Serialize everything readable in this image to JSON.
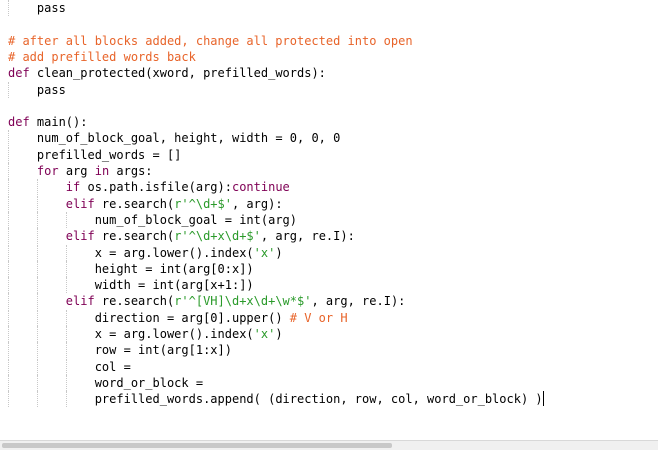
{
  "editor": {
    "lines": [
      [
        "    ",
        "",
        "pass",
        ""
      ],
      [
        "",
        "",
        "",
        ""
      ],
      [
        "",
        "",
        "",
        "# after all blocks added, change all protected into open"
      ],
      [
        "",
        "",
        "",
        "# add prefilled words back"
      ],
      [
        "",
        "def",
        " clean_protected(xword, prefilled_words):",
        ""
      ],
      [
        "    ",
        "",
        "pass",
        ""
      ],
      [
        "",
        "",
        "",
        ""
      ],
      [
        "",
        "def",
        " main():",
        ""
      ],
      [
        "    ",
        "",
        "num_of_block_goal, height, width = 0, 0, 0",
        ""
      ],
      [
        "    ",
        "",
        "prefilled_words = []",
        ""
      ],
      [
        "    ",
        "for",
        " arg ",
        ""
      ],
      [
        "        ",
        "if",
        " os.path.isfile(arg):",
        ""
      ],
      [
        "        ",
        "elif",
        " re.search(",
        ""
      ],
      [
        "            ",
        "",
        "num_of_block_goal = int(arg)",
        ""
      ],
      [
        "        ",
        "elif",
        " re.search(",
        ""
      ],
      [
        "            ",
        "",
        "x = arg.lower().index(",
        ""
      ],
      [
        "            ",
        "",
        "height = int(arg[0:x])",
        ""
      ],
      [
        "            ",
        "",
        "width = int(arg[x+1:])",
        ""
      ],
      [
        "        ",
        "elif",
        " re.search(",
        ""
      ],
      [
        "            ",
        "",
        "direction = arg[0].upper() ",
        "# V or H"
      ],
      [
        "            ",
        "",
        "x = arg.lower().index(",
        ""
      ],
      [
        "            ",
        "",
        "row = int(arg[1:x])",
        ""
      ],
      [
        "            ",
        "",
        "col = ",
        ""
      ],
      [
        "            ",
        "",
        "word_or_block = ",
        ""
      ],
      [
        "            ",
        "",
        "prefilled_words.append( (direction, row, col, word_or_block) )",
        ""
      ]
    ],
    "extras": {
      "10": [
        {
          "cls": "kw",
          "text": "in"
        },
        {
          "cls": "",
          "text": " args:"
        }
      ],
      "11": [
        {
          "cls": "kw",
          "text": "continue"
        }
      ],
      "12": [
        {
          "cls": "st",
          "text": "r'^\\d+$'"
        },
        {
          "cls": "",
          "text": ", arg):"
        }
      ],
      "14": [
        {
          "cls": "st",
          "text": "r'^\\d+x\\d+$'"
        },
        {
          "cls": "",
          "text": ", arg, re.I):"
        }
      ],
      "15": [
        {
          "cls": "st",
          "text": "'x'"
        },
        {
          "cls": "",
          "text": ")"
        }
      ],
      "18": [
        {
          "cls": "st",
          "text": "r'^[VH]\\d+x\\d+\\w*$'"
        },
        {
          "cls": "",
          "text": ", arg, re.I):"
        }
      ],
      "20": [
        {
          "cls": "st",
          "text": "'x'"
        },
        {
          "cls": "",
          "text": ")"
        }
      ]
    },
    "cursor_line": 24
  },
  "colors": {
    "keyword": "#7f0055",
    "comment": "#e8642a",
    "string": "#2a9a2a"
  }
}
